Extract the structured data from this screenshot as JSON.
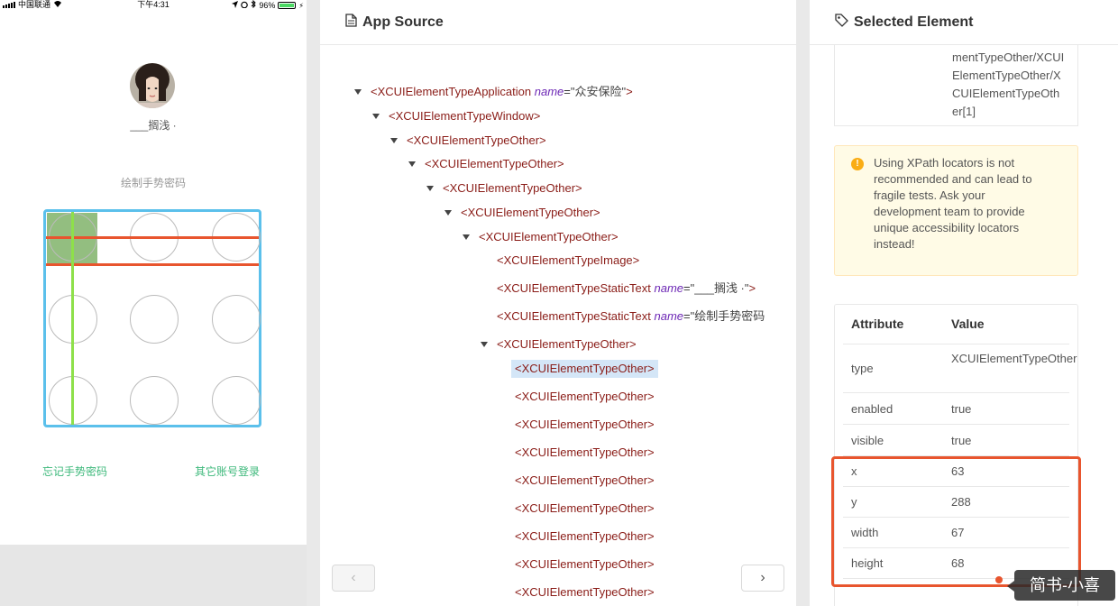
{
  "phone": {
    "status": {
      "carrier": "中国联通",
      "time": "下午4:31",
      "battery": "96%",
      "battery_level": 0.96
    },
    "username": "___搁浅 ·",
    "gesture_title": "绘制手势密码",
    "forgot_link": "忘记手势密码",
    "other_login_link": "其它账号登录"
  },
  "source": {
    "title": "App Source",
    "nodes": [
      {
        "tag": "<XCUIElementTypeApplication",
        "attr": "name",
        "val": "\"众安保险\"",
        "close": ">"
      },
      {
        "tag": "<XCUIElementTypeWindow>"
      },
      {
        "tag": "<XCUIElementTypeOther>"
      },
      {
        "tag": "<XCUIElementTypeOther>"
      },
      {
        "tag": "<XCUIElementTypeOther>"
      },
      {
        "tag": "<XCUIElementTypeOther>"
      },
      {
        "tag": "<XCUIElementTypeOther>"
      },
      {
        "tag": "<XCUIElementTypeImage>"
      },
      {
        "tag": "<XCUIElementTypeStaticText",
        "attr": "name",
        "val": "\"___搁浅 ·\"",
        "close": ">"
      },
      {
        "tag": "<XCUIElementTypeStaticText",
        "attr": "name",
        "val": "\"绘制手势密码",
        "close": ""
      },
      {
        "tag": "<XCUIElementTypeOther>"
      },
      {
        "tag": "<XCUIElementTypeOther>"
      },
      {
        "tag": "<XCUIElementTypeOther>"
      },
      {
        "tag": "<XCUIElementTypeOther>"
      },
      {
        "tag": "<XCUIElementTypeOther>"
      },
      {
        "tag": "<XCUIElementTypeOther>"
      },
      {
        "tag": "<XCUIElementTypeOther>"
      },
      {
        "tag": "<XCUIElementTypeOther>"
      },
      {
        "tag": "<XCUIElementTypeOther>"
      },
      {
        "tag": "<XCUIElementTypeOther>"
      }
    ],
    "prev_label": "‹",
    "next_label": "›"
  },
  "selected": {
    "title": "Selected Element",
    "xpath_fragment": "mentTypeOther/XCUIElementTypeOther/XCUIElementTypeOther[1]",
    "warning": "Using XPath locators is not recommended and can lead to fragile tests. Ask your development team to provide unique accessibility locators instead!",
    "table": {
      "header_attr": "Attribute",
      "header_value": "Value",
      "rows": [
        {
          "k": "type",
          "v": "XCUIElementTypeOther"
        },
        {
          "k": "enabled",
          "v": "true"
        },
        {
          "k": "visible",
          "v": "true"
        },
        {
          "k": "x",
          "v": "63"
        },
        {
          "k": "y",
          "v": "288"
        },
        {
          "k": "width",
          "v": "67"
        },
        {
          "k": "height",
          "v": "68"
        }
      ]
    }
  },
  "watermark": "简书-小喜",
  "colors": {
    "accent_blue": "#5bc0eb",
    "highlight_red": "#e8552e",
    "link_green": "#3cb87a",
    "gesture_green": "#8ee04a"
  }
}
